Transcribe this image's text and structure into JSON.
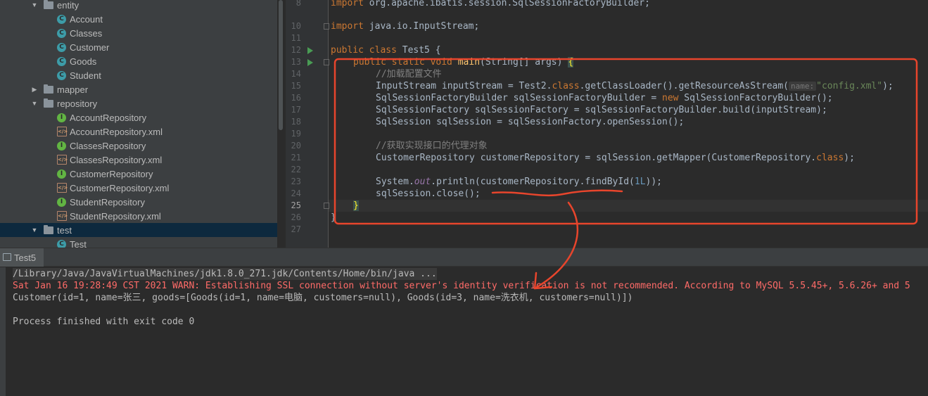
{
  "project_tree": {
    "items": [
      {
        "label": "entity",
        "kind": "folder",
        "state": "expanded"
      },
      {
        "label": "Account",
        "kind": "class"
      },
      {
        "label": "Classes",
        "kind": "class"
      },
      {
        "label": "Customer",
        "kind": "class"
      },
      {
        "label": "Goods",
        "kind": "class"
      },
      {
        "label": "Student",
        "kind": "class"
      },
      {
        "label": "mapper",
        "kind": "folder",
        "state": "collapsed"
      },
      {
        "label": "repository",
        "kind": "folder",
        "state": "expanded"
      },
      {
        "label": "AccountRepository",
        "kind": "interface"
      },
      {
        "label": "AccountRepository.xml",
        "kind": "xml"
      },
      {
        "label": "ClassesRepository",
        "kind": "interface"
      },
      {
        "label": "ClassesRepository.xml",
        "kind": "xml"
      },
      {
        "label": "CustomerRepository",
        "kind": "interface"
      },
      {
        "label": "CustomerRepository.xml",
        "kind": "xml"
      },
      {
        "label": "StudentRepository",
        "kind": "interface"
      },
      {
        "label": "StudentRepository.xml",
        "kind": "xml"
      },
      {
        "label": "test",
        "kind": "folder",
        "state": "expanded",
        "selected": true
      },
      {
        "label": "Test",
        "kind": "test-class"
      }
    ],
    "icon_letters": {
      "class": "C",
      "interface": "I",
      "xml": "</>"
    }
  },
  "editor": {
    "line_numbers": [
      "8",
      "10",
      "11",
      "12",
      "13",
      "14",
      "15",
      "16",
      "17",
      "18",
      "19",
      "20",
      "21",
      "22",
      "23",
      "24",
      "25",
      "26",
      "27"
    ],
    "lines": {
      "l8_kw": "import",
      "l8_rest": " org.apache.ibatis.session.SqlSessionFactoryBuilder;",
      "l10_kw": "import",
      "l10_rest": " java.io.InputStream;",
      "l12_kw": "public class",
      "l12_rest": " Test5 {",
      "l13_kw": "public static void",
      "l13_method": "main",
      "l13_rest": "(String[] args) ",
      "l13_brace": "{",
      "l14": "//加载配置文件",
      "l15_a": "InputStream inputStream = Test2.",
      "l15_kw": "class",
      "l15_b": ".getClassLoader().getResourceAsStream(",
      "l15_hint": "name:",
      "l15_str": "\"config.xml\"",
      "l15_c": ");",
      "l16_a": "SqlSessionFactoryBuilder sqlSessionFactoryBuilder = ",
      "l16_kw": "new",
      "l16_b": " SqlSessionFactoryBuilder();",
      "l17": "SqlSessionFactory sqlSessionFactory = sqlSessionFactoryBuilder.build(inputStream);",
      "l18": "SqlSession sqlSession = sqlSessionFactory.openSession();",
      "l20": "//获取实现接口的代理对象",
      "l21_a": "CustomerRepository customerRepository = sqlSession.getMapper(CustomerRepository.",
      "l21_kw": "class",
      "l21_b": ");",
      "l23_a": "System.",
      "l23_field": "out",
      "l23_b": ".println(customerRepository.findById(",
      "l23_num": "1L",
      "l23_c": "));",
      "l24": "sqlSession.close();",
      "l25": "}",
      "l26": "}"
    }
  },
  "run_panel": {
    "tab_label": "Test5",
    "output": {
      "path": "/Library/Java/JavaVirtualMachines/jdk1.8.0_271.jdk/Contents/Home/bin/java ...",
      "warning": "Sat Jan 16 19:28:49 CST 2021 WARN: Establishing SSL connection without server's identity verification is not recommended. According to MySQL 5.5.45+, 5.6.26+ and 5",
      "result": "Customer(id=1, name=张三, goods=[Goods(id=1, name=电脑, customers=null), Goods(id=3, name=洗衣机, customers=null)])",
      "exit": "Process finished with exit code 0"
    }
  },
  "colors": {
    "annotation": "#e8452c",
    "keyword": "#cc7832",
    "string": "#6a8759",
    "comment": "#808080",
    "warning_text": "#ff6b68"
  }
}
